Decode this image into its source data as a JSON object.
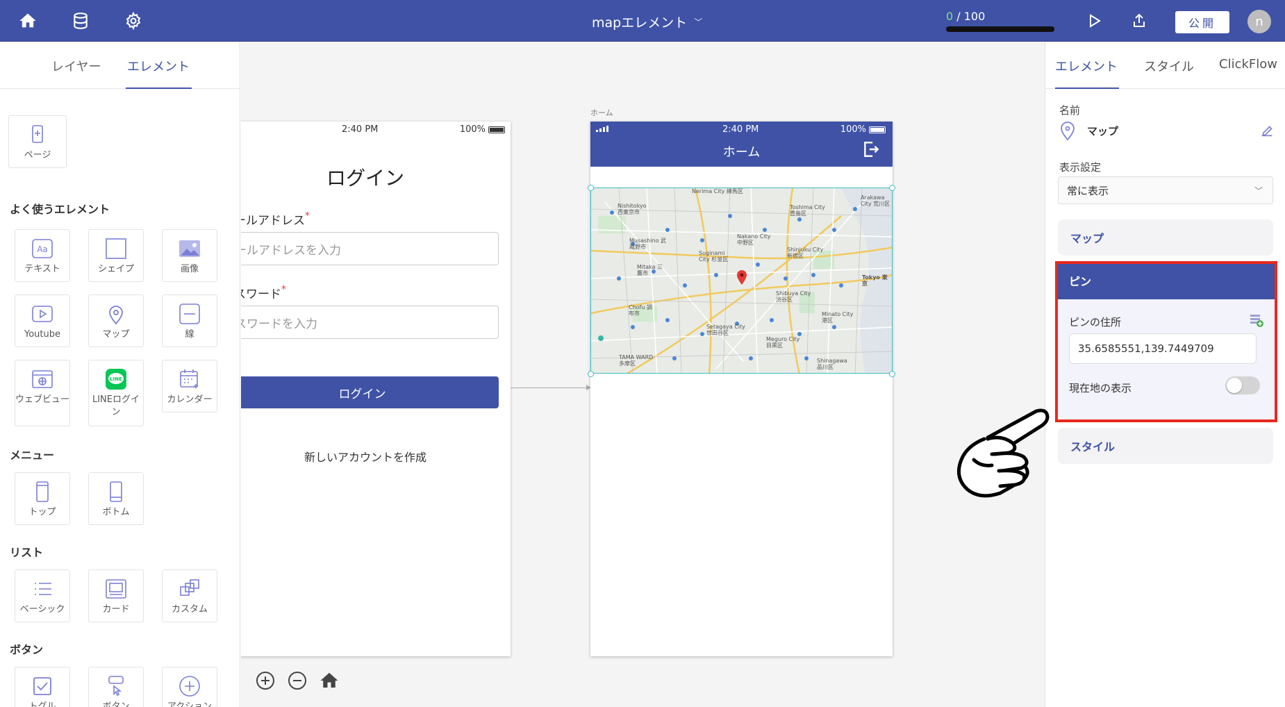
{
  "topbar": {
    "title": "mapエレメント",
    "quota_used": "0",
    "quota_total": " / 100",
    "quota_fraction": 0,
    "publish_label": "公開",
    "avatar_initial": "n"
  },
  "left": {
    "tabs": [
      "レイヤー",
      "エレメント"
    ],
    "page_card": "ページ",
    "sections": {
      "common": "よく使うエレメント",
      "menu": "メニュー",
      "list": "リスト",
      "button": "ボタン"
    },
    "common_items": [
      "テキスト",
      "シェイプ",
      "画像",
      "Youtube",
      "マップ",
      "線",
      "ウェブビュー",
      "LINEログイン",
      "カレンダー"
    ],
    "menu_items": [
      "トップ",
      "ボトム"
    ],
    "list_items": [
      "ベーシック",
      "カード",
      "カスタム"
    ],
    "button_items": [
      "トグル",
      "ボタン",
      "アクション"
    ]
  },
  "canvas": {
    "login_screen": {
      "time": "2:40 PM",
      "battery": "100%",
      "title": "ログイン",
      "email_label": "ールアドレス",
      "email_placeholder": "ールアドレスを入力",
      "password_label": "スワード",
      "password_placeholder": "スワードを入力",
      "required_mark": "*",
      "login_button": "ログイン",
      "create_account": "新しいアカウントを作成"
    },
    "home_screen": {
      "screen_label": "ホーム",
      "time": "2:40 PM",
      "battery": "100%",
      "title": "ホーム",
      "map_labels": [
        {
          "text": "Nerima City 練馬区"
        },
        {
          "text": "Nishitokyo 西東京市"
        },
        {
          "text": "Toshima City 豊島区"
        },
        {
          "text": "Arakawa City 荒川区"
        },
        {
          "text": "Musashino 武蔵野市"
        },
        {
          "text": "Nakano City 中野区"
        },
        {
          "text": "Suginami City 杉並区"
        },
        {
          "text": "Shinjuku City 新宿区"
        },
        {
          "text": "Mitaka 三鷹市"
        },
        {
          "text": "Tokyo 東京"
        },
        {
          "text": "Shibuya City 渋谷区"
        },
        {
          "text": "Chofu 調布市"
        },
        {
          "text": "Minato City 港区"
        },
        {
          "text": "Setagaya City 世田谷区"
        },
        {
          "text": "Meguro City 目黒区"
        },
        {
          "text": "Shinagawa 品川区"
        },
        {
          "text": "TAMA WARD 多摩区"
        }
      ]
    }
  },
  "right": {
    "tabs": [
      "エレメント",
      "スタイル",
      "ClickFlow"
    ],
    "name_label": "名前",
    "name_value": "マップ",
    "display_label": "表示設定",
    "display_value": "常に表示",
    "map_section": "マップ",
    "pin_section": "ピン",
    "pin_address_label": "ピンの住所",
    "pin_address_value": "35.6585551,139.7449709",
    "current_location_label": "現在地の表示",
    "style_section": "スタイル"
  },
  "colors": {
    "primary": "#3f52a6",
    "highlight": "#e8291c",
    "quota": "#7ee08a"
  }
}
